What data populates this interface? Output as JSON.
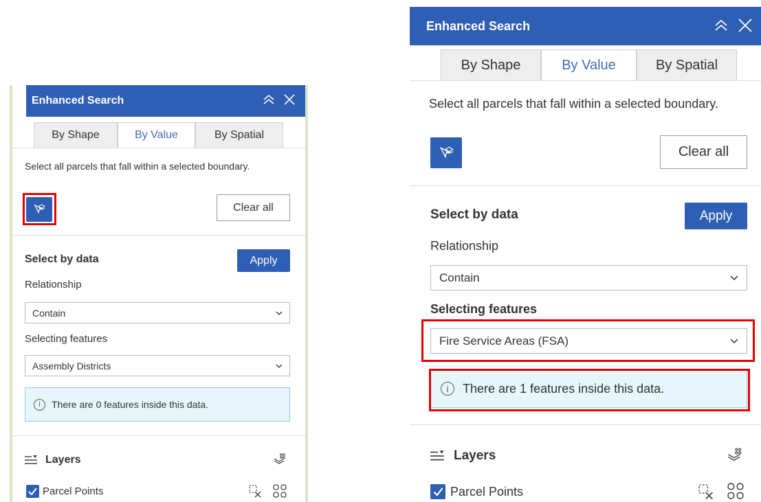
{
  "left_panel": {
    "header": {
      "title": "Enhanced Search"
    },
    "tabs": [
      {
        "label": "By Shape",
        "active": false
      },
      {
        "label": "By Value",
        "active": true
      },
      {
        "label": "By Spatial",
        "active": false
      }
    ],
    "description": "Select all parcels that fall within a selected boundary.",
    "clear_all_label": "Clear all",
    "select_by_data_label": "Select by data",
    "apply_label": "Apply",
    "relationship_label": "Relationship",
    "relationship_value": "Contain",
    "selecting_features_label": "Selecting features",
    "selecting_features_value": "Assembly Districts",
    "info_text": "There are 0 features inside this data.",
    "layers_label": "Layers",
    "layer_items": [
      {
        "label": "Parcel Points",
        "checked": true
      }
    ]
  },
  "right_panel": {
    "header": {
      "title": "Enhanced Search"
    },
    "tabs": [
      {
        "label": "By Shape",
        "active": false
      },
      {
        "label": "By Value",
        "active": true
      },
      {
        "label": "By Spatial",
        "active": false
      }
    ],
    "description": "Select all parcels that fall within a selected boundary.",
    "clear_all_label": "Clear all",
    "select_by_data_label": "Select by data",
    "apply_label": "Apply",
    "relationship_label": "Relationship",
    "relationship_value": "Contain",
    "selecting_features_label": "Selecting features",
    "selecting_features_value": "Fire Service Areas (FSA)",
    "info_text": "There are 1 features inside this data.",
    "layers_label": "Layers",
    "layer_items": [
      {
        "label": "Parcel Points",
        "checked": true
      }
    ]
  },
  "icons": {
    "collapse": "double-chevron-up-icon",
    "close": "close-icon",
    "select_tool": "select-by-location-icon",
    "dropdown": "chevron-down-icon",
    "info": "info-icon",
    "layers": "layers-list-icon",
    "layer_options": "layer-stack-icon",
    "clear_selection": "clear-selection-icon",
    "grid": "grid-icon",
    "check": "check-icon"
  },
  "colors": {
    "header_bg": "#2f5fb4",
    "accent": "#2f5fb4",
    "active_tab_text": "#3f6db5",
    "info_bg": "#e6f6fa",
    "info_border": "#8ecfe3",
    "highlight": "#e60000"
  }
}
